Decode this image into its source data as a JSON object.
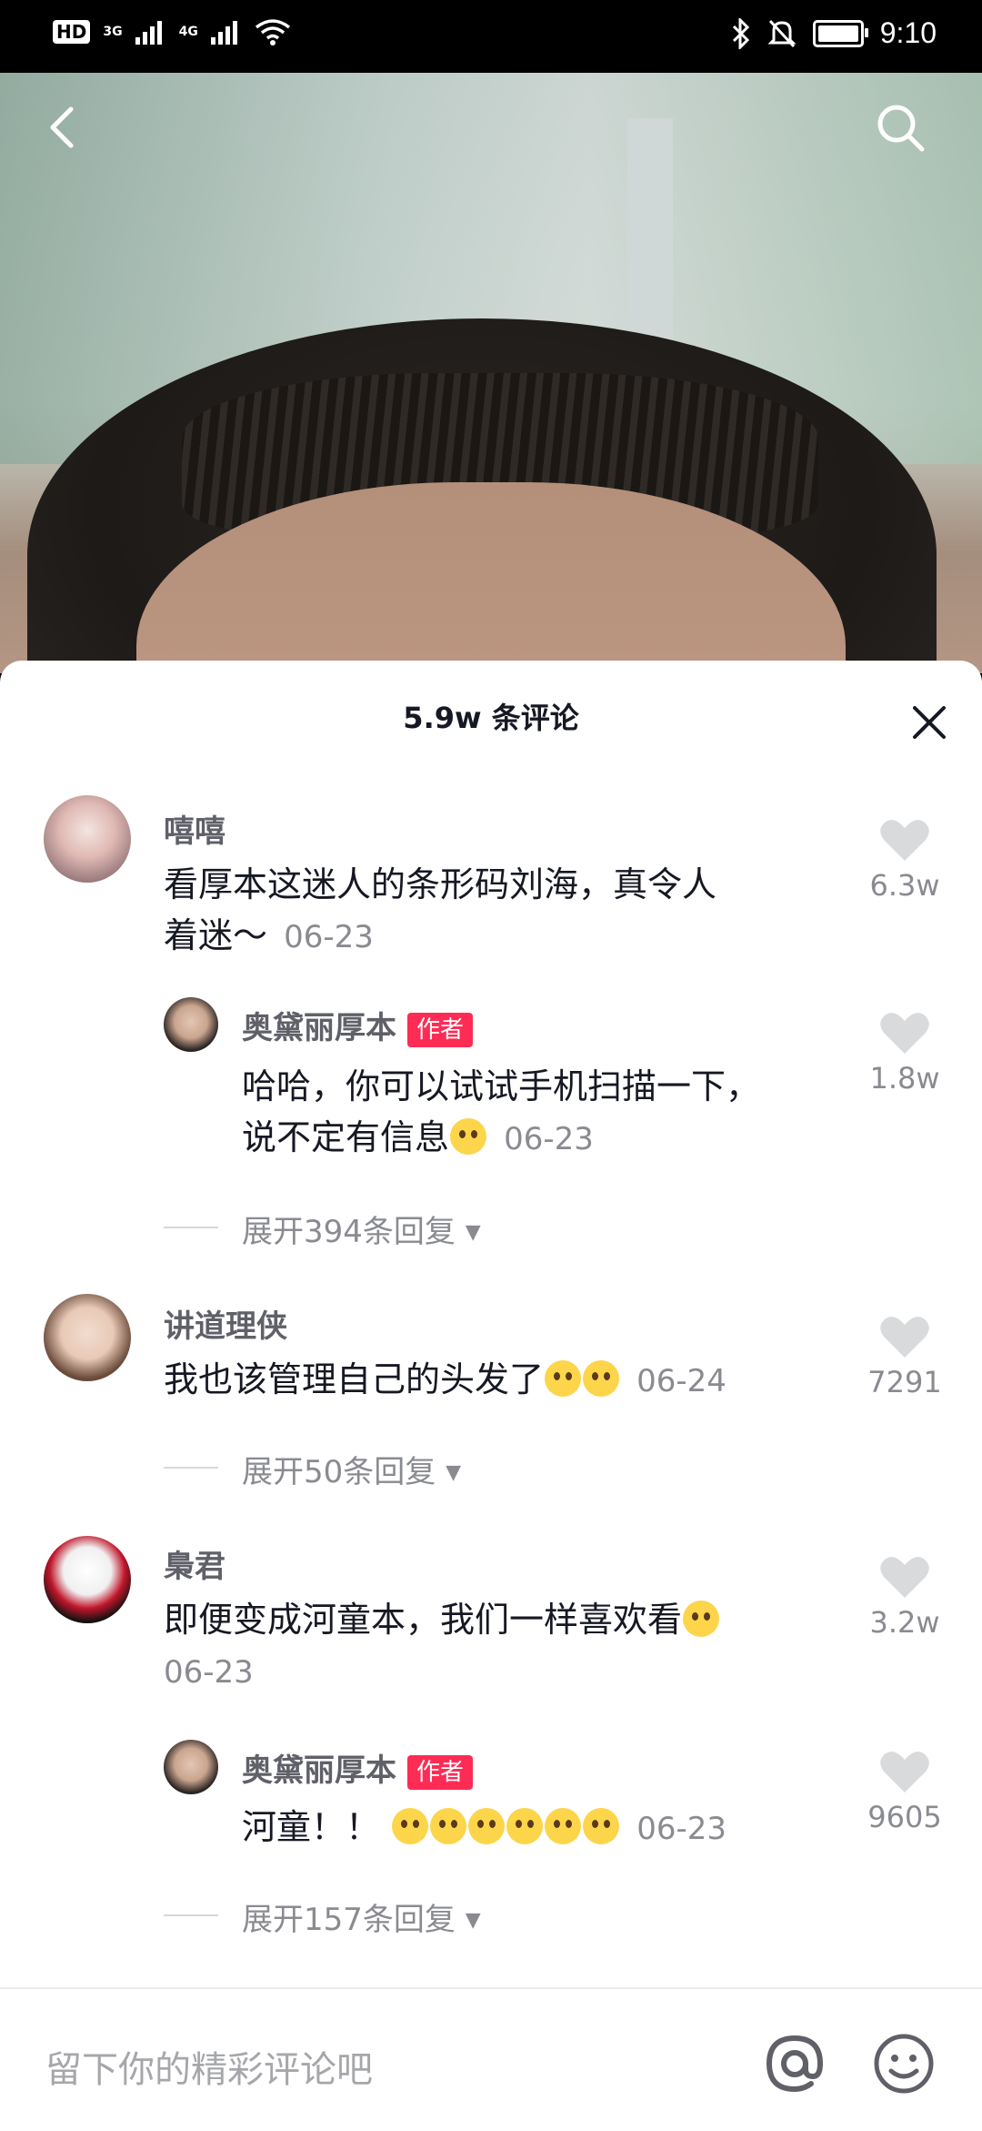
{
  "status_bar": {
    "hd": "HD",
    "net1": "3G",
    "net2": "4G",
    "time": "9:10",
    "battery_level": 0.9
  },
  "header": {
    "back_icon": "chevron-left-icon",
    "search_icon": "search-icon"
  },
  "comments_panel": {
    "title": "5.9w 条评论",
    "input_placeholder": "留下你的精彩评论吧",
    "comments": [
      {
        "name": "嘻嘻",
        "text_line1": "看厚本这迷人的条形码刘海，真令人",
        "text_line2": "着迷～",
        "date": "06-23",
        "likes": "6.3w"
      },
      {
        "name": "奥黛丽厚本",
        "tag": "作者",
        "text_line1": "哈哈，你可以试试手机扫描一下，",
        "text_line2": "说不定有信息",
        "date": "06-23",
        "likes": "1.8w"
      },
      {
        "expand": "展开394条回复"
      },
      {
        "name": "讲道理侠",
        "text_line1": "我也该管理自己的头发了",
        "date": "06-24",
        "likes": "7291"
      },
      {
        "expand": "展开50条回复"
      },
      {
        "name": "梟君",
        "text_line1": "即便变成河童本，我们一样喜欢看",
        "date": "06-23",
        "likes": "3.2w"
      },
      {
        "name": "奥黛丽厚本",
        "tag": "作者",
        "text_line1": "河童！！",
        "date": "06-23",
        "likes": "9605"
      },
      {
        "expand": "展开157条回复"
      }
    ]
  }
}
